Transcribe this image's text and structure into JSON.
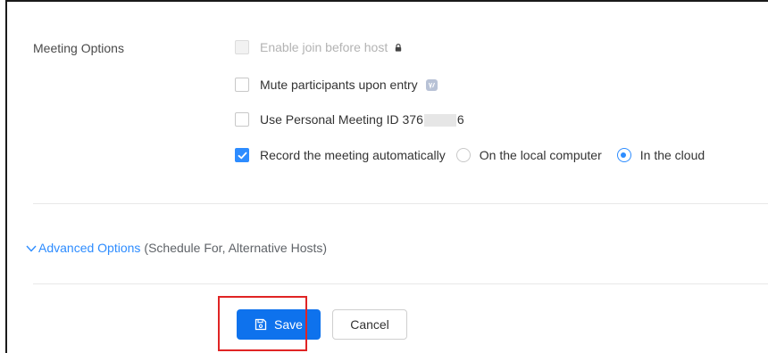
{
  "meeting_options": {
    "section_label": "Meeting Options",
    "options": [
      {
        "label": "Enable join before host",
        "checked": false,
        "disabled": true,
        "icon": "lock-icon"
      },
      {
        "label": "Mute participants upon entry",
        "checked": false,
        "disabled": false,
        "icon": "info-badge-icon"
      },
      {
        "label_prefix": "Use Personal Meeting ID 376",
        "label_suffix": "6",
        "checked": false,
        "disabled": false
      },
      {
        "label": "Record the meeting automatically",
        "checked": true,
        "disabled": false
      }
    ],
    "record_location": {
      "options": [
        "On the local computer",
        "In the cloud"
      ],
      "selected": "In the cloud"
    }
  },
  "advanced_options": {
    "link_label": "Advanced Options",
    "note": "(Schedule For, Alternative Hosts)",
    "icon": "chevron-down-icon"
  },
  "actions": {
    "save_label": "Save",
    "cancel_label": "Cancel",
    "save_icon": "floppy-disk-icon"
  },
  "colors": {
    "accent": "#2d8cff",
    "save_button": "#0e72ed",
    "highlight_box": "#e02424"
  }
}
